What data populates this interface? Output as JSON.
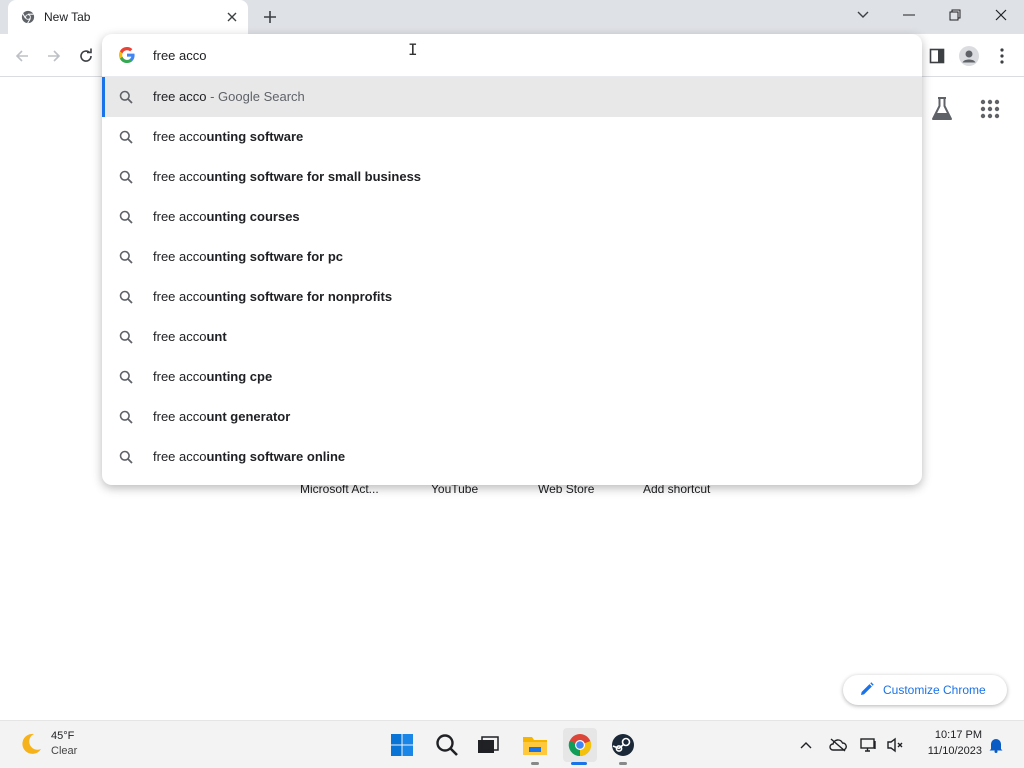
{
  "colors": {
    "accent": "#1a73e8",
    "tabstrip_bg": "#dee1e6",
    "selected_row": "#e8e8e9"
  },
  "browser": {
    "tab": {
      "title": "New Tab",
      "favicon": "chrome-icon",
      "close_icon": "close-icon"
    },
    "new_tab_icon": "plus-icon",
    "window_controls": [
      "chevron-down-icon",
      "minimize-icon",
      "restore-icon",
      "close-icon"
    ]
  },
  "omnibox": {
    "value": "free acco",
    "suggestions": [
      {
        "typed": "free acco",
        "completion": "",
        "suffix": " - Google Search",
        "selected": true
      },
      {
        "typed": "free acco",
        "completion": "unting software",
        "suffix": ""
      },
      {
        "typed": "free acco",
        "completion": "unting software for small business",
        "suffix": ""
      },
      {
        "typed": "free acco",
        "completion": "unting courses",
        "suffix": ""
      },
      {
        "typed": "free acco",
        "completion": "unting software for pc",
        "suffix": ""
      },
      {
        "typed": "free acco",
        "completion": "unting software for nonprofits",
        "suffix": ""
      },
      {
        "typed": "free acco",
        "completion": "unt",
        "suffix": ""
      },
      {
        "typed": "free acco",
        "completion": "unting cpe",
        "suffix": ""
      },
      {
        "typed": "free acco",
        "completion": "unt generator",
        "suffix": ""
      },
      {
        "typed": "free acco",
        "completion": "unting software online",
        "suffix": ""
      }
    ]
  },
  "page": {
    "shortcuts": [
      "Microsoft Act...",
      "YouTube",
      "Web Store",
      "Add shortcut"
    ],
    "customize_label": "Customize Chrome"
  },
  "taskbar": {
    "weather": {
      "temp": "45°F",
      "desc": "Clear"
    },
    "clock": {
      "time": "10:17 PM",
      "date": "11/10/2023"
    }
  }
}
